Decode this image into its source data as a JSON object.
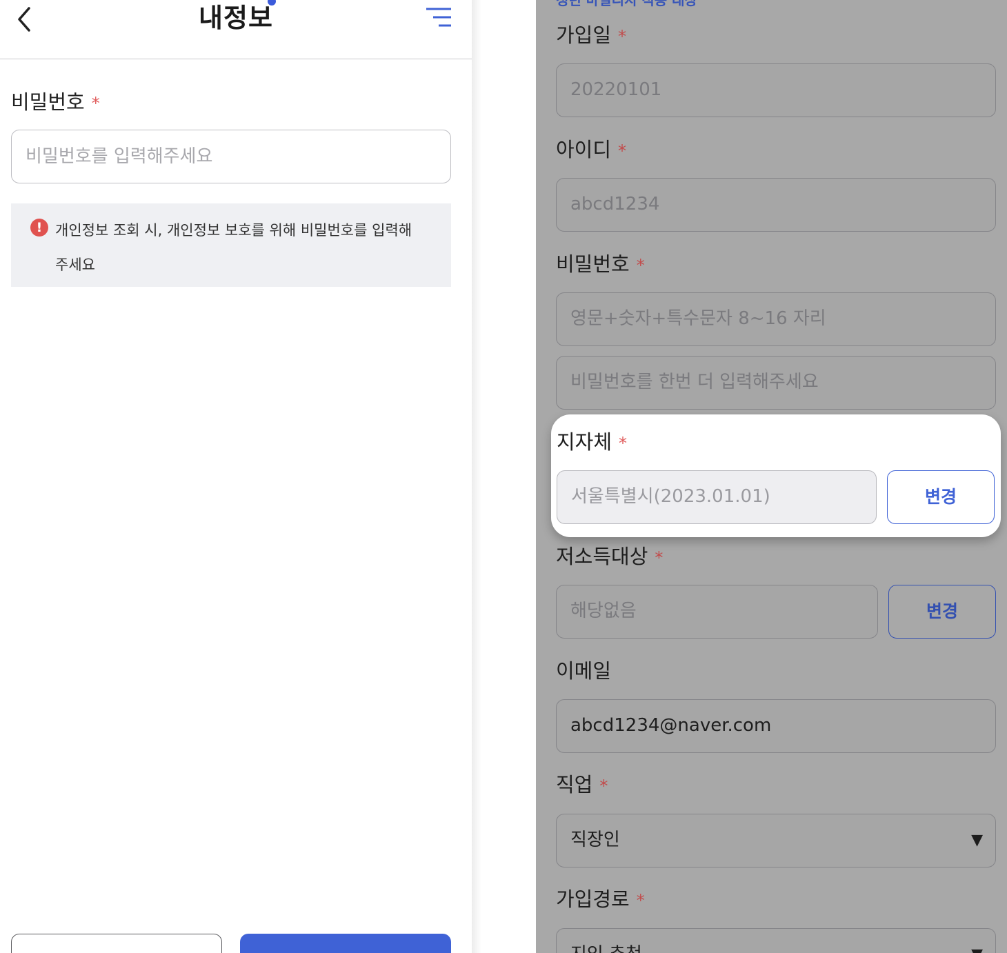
{
  "left": {
    "header": {
      "title": "내정보"
    },
    "password": {
      "label": "비밀번호",
      "required_mark": "*",
      "placeholder": "비밀번호를 입력해주세요"
    },
    "notice": {
      "icon_glyph": "!",
      "text": "개인정보 조회 시, 개인정보 보호를 위해 비밀번호를 입력해주세요"
    }
  },
  "right": {
    "top_cut_text": "청년 마일리지 적용 대상",
    "join_date": {
      "label": "가입일",
      "required_mark": "*",
      "value": "20220101"
    },
    "user_id": {
      "label": "아이디",
      "required_mark": "*",
      "value": "abcd1234"
    },
    "password": {
      "label": "비밀번호",
      "required_mark": "*",
      "placeholder": "영문+숫자+특수문자 8~16 자리",
      "confirm_placeholder": "비밀번호를 한번 더 입력해주세요"
    },
    "region": {
      "label": "지자체",
      "required_mark": "*",
      "value": "서울특별시(2023.01.01)",
      "button": "변경"
    },
    "low_income": {
      "label": "저소득대상",
      "required_mark": "*",
      "value": "해당없음",
      "button": "변경"
    },
    "email": {
      "label": "이메일",
      "value": "abcd1234@naver.com"
    },
    "job": {
      "label": "직업",
      "required_mark": "*",
      "value": "직장인",
      "arrow": "▼"
    },
    "join_path": {
      "label": "가입경로",
      "required_mark": "*",
      "value": "지인 추천",
      "arrow": "▼"
    }
  },
  "colors": {
    "accent": "#3f62d6",
    "required": "#e05a5a",
    "overlay": "#a8a8a8"
  },
  "icons": {
    "back": "chevron-left-icon",
    "menu": "menu-icon",
    "notice": "exclamation-icon"
  }
}
